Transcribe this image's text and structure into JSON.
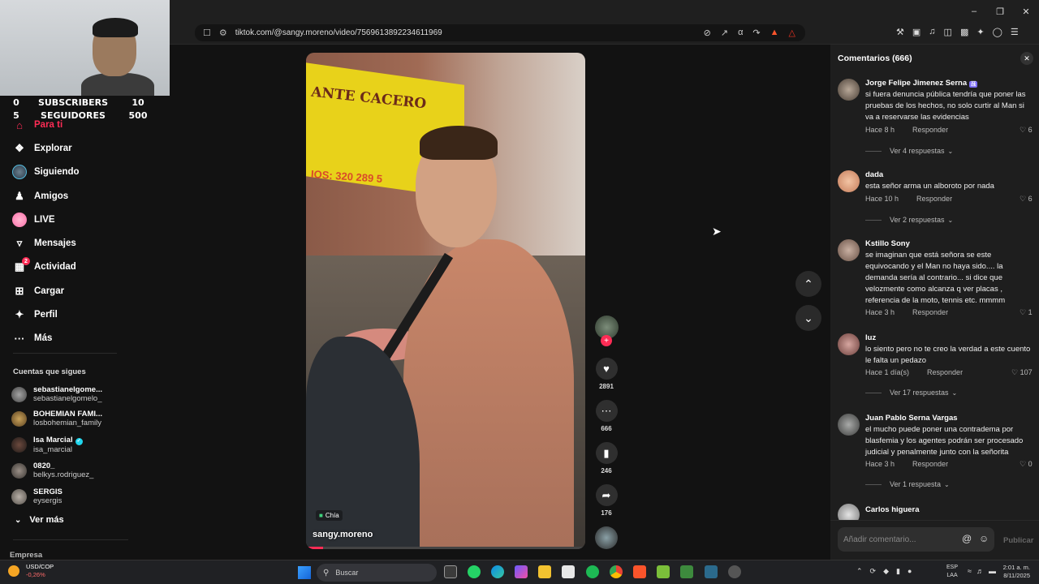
{
  "browser": {
    "url": "tiktok.com/@sangy.moreno/video/7569613892234611969"
  },
  "webcam_overlay": {
    "subs_current": "0",
    "subs_label": "SUBSCRIBERS",
    "subs_goal": "10",
    "followers_current": "5",
    "followers_label": "SEGUIDORES",
    "followers_goal": "500"
  },
  "sidebar": {
    "nav": [
      {
        "label": "Para ti",
        "icon": "home-icon"
      },
      {
        "label": "Explorar",
        "icon": "compass-icon"
      },
      {
        "label": "Siguiendo",
        "icon": "following-avatar"
      },
      {
        "label": "Amigos",
        "icon": "friends-icon"
      },
      {
        "label": "LIVE",
        "icon": "live-icon"
      },
      {
        "label": "Mensajes",
        "icon": "messages-icon"
      },
      {
        "label": "Actividad",
        "icon": "activity-icon",
        "badge": "2"
      },
      {
        "label": "Cargar",
        "icon": "upload-icon"
      },
      {
        "label": "Perfil",
        "icon": "profile-icon"
      },
      {
        "label": "Más",
        "icon": "more-icon"
      }
    ],
    "following_title": "Cuentas que sigues",
    "accounts": [
      {
        "name": "sebastianelgome...",
        "handle": "sebastianelgomelo_"
      },
      {
        "name": "BOHEMIAN FAMI...",
        "handle": "losbohemian_family"
      },
      {
        "name": "Isa Marcial",
        "handle": "isa_marcial",
        "verified": true
      },
      {
        "name": "0820_",
        "handle": "belkys.rodriguez_"
      },
      {
        "name": "SERGIS",
        "handle": "eysergis"
      }
    ],
    "see_more": "Ver más",
    "company": "Empresa"
  },
  "video": {
    "author": "sangy.moreno",
    "location": "Chía",
    "sign_text": "ANTE CACERO",
    "sign_phone": "IOS: 320 289 5",
    "progress_fraction": 0.06,
    "likes": "2891",
    "comments": "666",
    "saves": "246",
    "shares": "176"
  },
  "comments": {
    "title": "Comentarios (666)",
    "input_placeholder": "Añadir comentario...",
    "publish_label": "Publicar",
    "reply_label": "Responder",
    "items": [
      {
        "name": "Jorge Felipe Jimenez Serna",
        "tag": "🇳",
        "text": "si fuera denuncia pública tendría que poner las pruebas de los hechos, no solo curtir al Man si va a reservarse las evidencias",
        "time": "Hace 8 h",
        "likes": "6",
        "replies": "Ver 4 respuestas"
      },
      {
        "name": "dada",
        "text": "esta señor arma un alboroto por nada",
        "time": "Hace 10 h",
        "likes": "6",
        "replies": "Ver 2 respuestas"
      },
      {
        "name": "Kstillo Sony",
        "text": "se imaginan que está señora se este equivocando y el Man no haya sido.... la demanda sería al contrario... si dice que velozmente como alcanza q ver placas , referencia de la moto, tennis etc. mmmm",
        "time": "Hace 3 h",
        "likes": "1"
      },
      {
        "name": "luz",
        "text": "lo siento pero no te creo la verdad a este cuento le falta un pedazo",
        "time": "Hace 1 día(s)",
        "likes": "107",
        "replies": "Ver 17 respuestas"
      },
      {
        "name": "Juan Pablo Serna Vargas",
        "text": "el mucho puede poner una contradema por blasfemia y los agentes podrán ser procesado judicial y penalmente junto con la señorita",
        "time": "Hace 3 h",
        "likes": "0",
        "replies": "Ver 1 respuesta"
      },
      {
        "name": "Carlos higuera"
      }
    ]
  },
  "taskbar": {
    "stock_pair": "USD/COP",
    "stock_change": "-0,26%",
    "search_label": "Buscar",
    "lang_line1": "ESP",
    "lang_line2": "LAA",
    "time": "2:01 a. m.",
    "date": "8/11/2025"
  },
  "colors": {
    "accent": "#fe2c55",
    "panel": "#1e1e1e",
    "background": "#121212"
  }
}
